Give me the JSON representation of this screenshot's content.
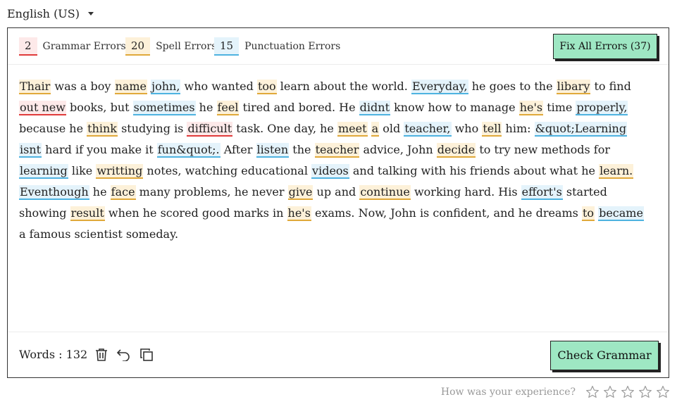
{
  "language": {
    "label": "English (US)"
  },
  "counts": {
    "grammar": {
      "value": "2",
      "label": "Grammar Errors"
    },
    "spell": {
      "value": "20",
      "label": "Spell Errors"
    },
    "punctuation": {
      "value": "15",
      "label": "Punctuation Errors"
    }
  },
  "fix_button_label": "Fix All Errors (37)",
  "colors": {
    "grammar": "#e03b3b",
    "spell": "#e0a93a",
    "punctuation": "#4eb3e0",
    "button": "#9ee7c3"
  },
  "segments": [
    {
      "t": "Thair",
      "e": "s"
    },
    {
      "t": " was a boy "
    },
    {
      "t": "name",
      "e": "s"
    },
    {
      "t": " "
    },
    {
      "t": "john,",
      "e": "p"
    },
    {
      "t": " who wanted "
    },
    {
      "t": "too",
      "e": "s"
    },
    {
      "t": " learn about the world. "
    },
    {
      "t": "Everyday,",
      "e": "p"
    },
    {
      "t": " he goes to the "
    },
    {
      "t": "libary",
      "e": "s"
    },
    {
      "t": " to find "
    },
    {
      "t": "out new",
      "e": "g"
    },
    {
      "t": " books, but "
    },
    {
      "t": "sometimes",
      "e": "p"
    },
    {
      "t": " he "
    },
    {
      "t": "feel",
      "e": "s"
    },
    {
      "t": " tired and bored. He "
    },
    {
      "t": "didnt",
      "e": "p"
    },
    {
      "t": " know how to manage "
    },
    {
      "t": "he's",
      "e": "s"
    },
    {
      "t": " time "
    },
    {
      "t": "properly,",
      "e": "p"
    },
    {
      "t": " because he "
    },
    {
      "t": "think",
      "e": "s"
    },
    {
      "t": " studying is "
    },
    {
      "t": "difficult",
      "e": "g"
    },
    {
      "t": " task. One day, he "
    },
    {
      "t": "meet",
      "e": "s"
    },
    {
      "t": " "
    },
    {
      "t": "a",
      "e": "s"
    },
    {
      "t": " old "
    },
    {
      "t": "teacher,",
      "e": "p"
    },
    {
      "t": " who "
    },
    {
      "t": "tell",
      "e": "s"
    },
    {
      "t": " him: "
    },
    {
      "t": "&quot;Learning",
      "e": "p"
    },
    {
      "t": " "
    },
    {
      "t": "isnt",
      "e": "p"
    },
    {
      "t": " hard if you make it "
    },
    {
      "t": "fun&quot;.",
      "e": "p"
    },
    {
      "t": " After "
    },
    {
      "t": "listen",
      "e": "p"
    },
    {
      "t": " the "
    },
    {
      "t": "teacher",
      "e": "s"
    },
    {
      "t": " advice, John "
    },
    {
      "t": "decide",
      "e": "s"
    },
    {
      "t": " to try new methods for "
    },
    {
      "t": "learning",
      "e": "p"
    },
    {
      "t": " like "
    },
    {
      "t": "writting",
      "e": "s"
    },
    {
      "t": " notes, watching "
    },
    {
      "t": "educational "
    },
    {
      "t": "videos",
      "e": "p"
    },
    {
      "t": " and talking with his friends about what he "
    },
    {
      "t": "learn.",
      "e": "s"
    },
    {
      "t": " "
    },
    {
      "t": "Eventhough",
      "e": "p"
    },
    {
      "t": " he "
    },
    {
      "t": "face",
      "e": "s"
    },
    {
      "t": " many problems, he never "
    },
    {
      "t": "give",
      "e": "s"
    },
    {
      "t": " up and "
    },
    {
      "t": "continue",
      "e": "s"
    },
    {
      "t": " working hard. His "
    },
    {
      "t": "effort's",
      "e": "p"
    },
    {
      "t": " started showing "
    },
    {
      "t": "result",
      "e": "s"
    },
    {
      "t": " when he scored good marks in "
    },
    {
      "t": "he's",
      "e": "s"
    },
    {
      "t": " exams. "
    },
    {
      "t": "Now, John is confident, and he dreams "
    },
    {
      "t": "to",
      "e": "s"
    },
    {
      "t": " "
    },
    {
      "t": "became",
      "e": "p"
    },
    {
      "t": " a famous scientist someday."
    }
  ],
  "word_count_label": "Words : 132",
  "check_button_label": "Check Grammar",
  "feedback": {
    "label": "How was your experience?",
    "max_stars": 5,
    "rating": 0
  },
  "icons": [
    "chevron-down-icon",
    "trash-icon",
    "undo-icon",
    "copy-icon",
    "star-icon"
  ]
}
